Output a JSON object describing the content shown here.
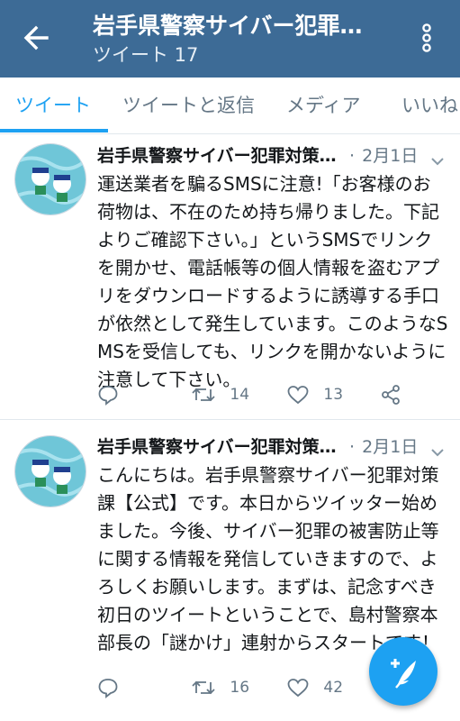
{
  "header": {
    "title": "岩手県警察サイバー犯罪対策課【公式】",
    "subtitle": "ツイート 17"
  },
  "tabs": [
    {
      "label": "ツイート",
      "active": true
    },
    {
      "label": "ツイートと返信",
      "active": false
    },
    {
      "label": "メディア",
      "active": false
    },
    {
      "label": "いいね",
      "active": false
    }
  ],
  "tweets": [
    {
      "name": "岩手県警察サイバー犯罪対策課【公式】",
      "date": "2月1日",
      "text": "運送業者を騙るSMSに注意!「お客様のお荷物は、不在のため持ち帰りました。下記よりご確認下さい。」というSMSでリンクを開かせ、電話帳等の個人情報を盗むアプリをダウンロードするように誘導する手口が依然として発生しています。このようなSMSを受信しても、リンクを開かないように注意して下さい。",
      "retweets": "14",
      "likes": "13"
    },
    {
      "name": "岩手県警察サイバー犯罪対策課【公式】",
      "date": "2月1日",
      "text": "こんにちは。岩手県警察サイバー犯罪対策課【公式】です。本日からツイッター始めました。今後、サイバー犯罪の被害防止等に関する情報を発信していきますので、よろしくお願いします。まずは、記念すべき初日のツイートということで、島村警察本部長の「謎かけ」連射からスタートです！",
      "retweets": "16",
      "likes": "42"
    }
  ],
  "colors": {
    "appbar": "#3d6b96",
    "accent": "#1da1f2",
    "muted": "#657786"
  },
  "icons": {
    "back": "arrow-left-icon",
    "more": "more-vert-icon",
    "reply": "reply-icon",
    "retweet": "retweet-icon",
    "like": "heart-icon",
    "share": "share-icon",
    "compose": "compose-feather-icon"
  }
}
